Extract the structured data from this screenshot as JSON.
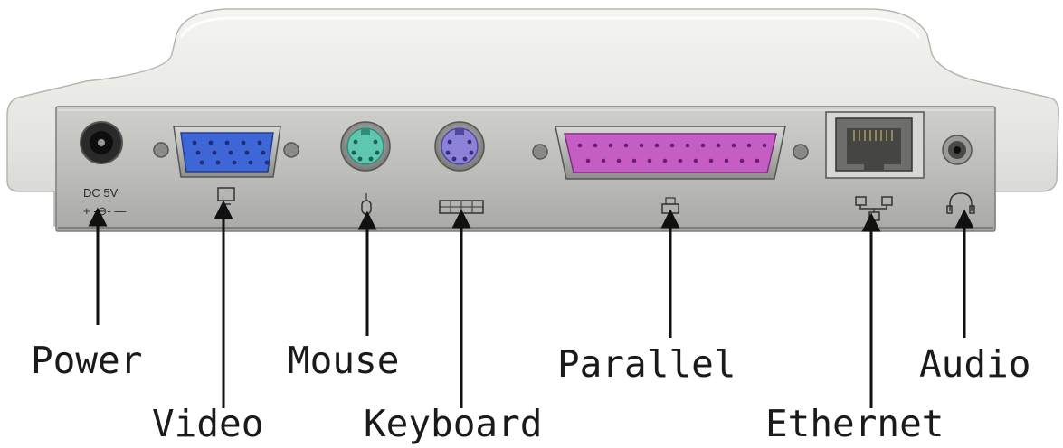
{
  "device_marking": {
    "power_rating": "DC  5V"
  },
  "ports": [
    {
      "id": "power",
      "label": "Power"
    },
    {
      "id": "video",
      "label": "Video"
    },
    {
      "id": "mouse",
      "label": "Mouse"
    },
    {
      "id": "keyboard",
      "label": "Keyboard"
    },
    {
      "id": "parallel",
      "label": "Parallel"
    },
    {
      "id": "ethernet",
      "label": "Ethernet"
    },
    {
      "id": "audio",
      "label": "Audio"
    }
  ],
  "colors": {
    "housing": "#e6e6e2",
    "panel": "#c2c2c0",
    "vga_port": "#3f66d6",
    "mouse_port": "#5fc6b0",
    "keyboard_port": "#8c82d8",
    "parallel_port": "#c45ec4",
    "arrow": "#111111"
  }
}
